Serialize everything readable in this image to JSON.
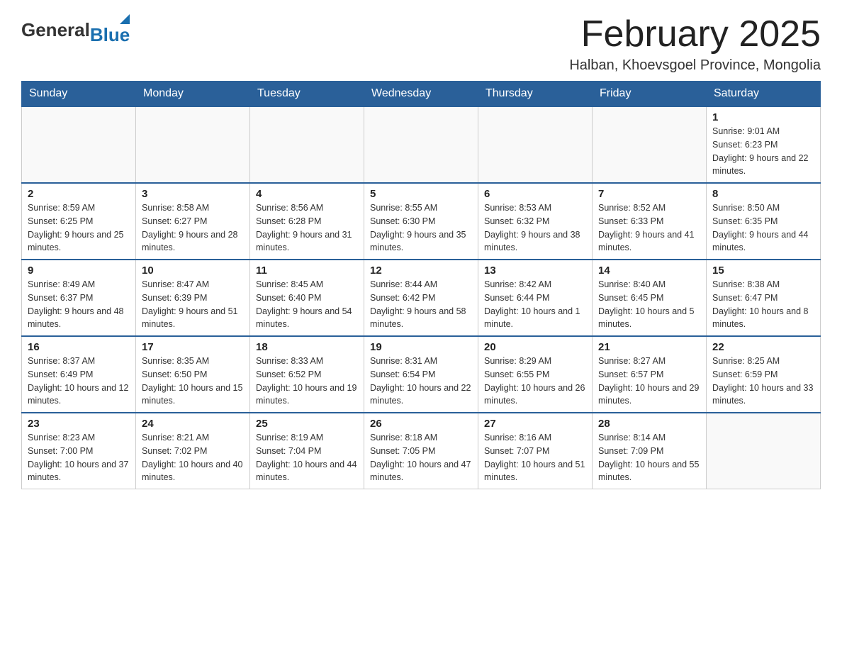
{
  "header": {
    "logo_general": "General",
    "logo_blue": "Blue",
    "title": "February 2025",
    "subtitle": "Halban, Khoevsgoel Province, Mongolia"
  },
  "days_of_week": [
    "Sunday",
    "Monday",
    "Tuesday",
    "Wednesday",
    "Thursday",
    "Friday",
    "Saturday"
  ],
  "weeks": [
    [
      {
        "day": "",
        "info": ""
      },
      {
        "day": "",
        "info": ""
      },
      {
        "day": "",
        "info": ""
      },
      {
        "day": "",
        "info": ""
      },
      {
        "day": "",
        "info": ""
      },
      {
        "day": "",
        "info": ""
      },
      {
        "day": "1",
        "info": "Sunrise: 9:01 AM\nSunset: 6:23 PM\nDaylight: 9 hours and 22 minutes."
      }
    ],
    [
      {
        "day": "2",
        "info": "Sunrise: 8:59 AM\nSunset: 6:25 PM\nDaylight: 9 hours and 25 minutes."
      },
      {
        "day": "3",
        "info": "Sunrise: 8:58 AM\nSunset: 6:27 PM\nDaylight: 9 hours and 28 minutes."
      },
      {
        "day": "4",
        "info": "Sunrise: 8:56 AM\nSunset: 6:28 PM\nDaylight: 9 hours and 31 minutes."
      },
      {
        "day": "5",
        "info": "Sunrise: 8:55 AM\nSunset: 6:30 PM\nDaylight: 9 hours and 35 minutes."
      },
      {
        "day": "6",
        "info": "Sunrise: 8:53 AM\nSunset: 6:32 PM\nDaylight: 9 hours and 38 minutes."
      },
      {
        "day": "7",
        "info": "Sunrise: 8:52 AM\nSunset: 6:33 PM\nDaylight: 9 hours and 41 minutes."
      },
      {
        "day": "8",
        "info": "Sunrise: 8:50 AM\nSunset: 6:35 PM\nDaylight: 9 hours and 44 minutes."
      }
    ],
    [
      {
        "day": "9",
        "info": "Sunrise: 8:49 AM\nSunset: 6:37 PM\nDaylight: 9 hours and 48 minutes."
      },
      {
        "day": "10",
        "info": "Sunrise: 8:47 AM\nSunset: 6:39 PM\nDaylight: 9 hours and 51 minutes."
      },
      {
        "day": "11",
        "info": "Sunrise: 8:45 AM\nSunset: 6:40 PM\nDaylight: 9 hours and 54 minutes."
      },
      {
        "day": "12",
        "info": "Sunrise: 8:44 AM\nSunset: 6:42 PM\nDaylight: 9 hours and 58 minutes."
      },
      {
        "day": "13",
        "info": "Sunrise: 8:42 AM\nSunset: 6:44 PM\nDaylight: 10 hours and 1 minute."
      },
      {
        "day": "14",
        "info": "Sunrise: 8:40 AM\nSunset: 6:45 PM\nDaylight: 10 hours and 5 minutes."
      },
      {
        "day": "15",
        "info": "Sunrise: 8:38 AM\nSunset: 6:47 PM\nDaylight: 10 hours and 8 minutes."
      }
    ],
    [
      {
        "day": "16",
        "info": "Sunrise: 8:37 AM\nSunset: 6:49 PM\nDaylight: 10 hours and 12 minutes."
      },
      {
        "day": "17",
        "info": "Sunrise: 8:35 AM\nSunset: 6:50 PM\nDaylight: 10 hours and 15 minutes."
      },
      {
        "day": "18",
        "info": "Sunrise: 8:33 AM\nSunset: 6:52 PM\nDaylight: 10 hours and 19 minutes."
      },
      {
        "day": "19",
        "info": "Sunrise: 8:31 AM\nSunset: 6:54 PM\nDaylight: 10 hours and 22 minutes."
      },
      {
        "day": "20",
        "info": "Sunrise: 8:29 AM\nSunset: 6:55 PM\nDaylight: 10 hours and 26 minutes."
      },
      {
        "day": "21",
        "info": "Sunrise: 8:27 AM\nSunset: 6:57 PM\nDaylight: 10 hours and 29 minutes."
      },
      {
        "day": "22",
        "info": "Sunrise: 8:25 AM\nSunset: 6:59 PM\nDaylight: 10 hours and 33 minutes."
      }
    ],
    [
      {
        "day": "23",
        "info": "Sunrise: 8:23 AM\nSunset: 7:00 PM\nDaylight: 10 hours and 37 minutes."
      },
      {
        "day": "24",
        "info": "Sunrise: 8:21 AM\nSunset: 7:02 PM\nDaylight: 10 hours and 40 minutes."
      },
      {
        "day": "25",
        "info": "Sunrise: 8:19 AM\nSunset: 7:04 PM\nDaylight: 10 hours and 44 minutes."
      },
      {
        "day": "26",
        "info": "Sunrise: 8:18 AM\nSunset: 7:05 PM\nDaylight: 10 hours and 47 minutes."
      },
      {
        "day": "27",
        "info": "Sunrise: 8:16 AM\nSunset: 7:07 PM\nDaylight: 10 hours and 51 minutes."
      },
      {
        "day": "28",
        "info": "Sunrise: 8:14 AM\nSunset: 7:09 PM\nDaylight: 10 hours and 55 minutes."
      },
      {
        "day": "",
        "info": ""
      }
    ]
  ]
}
